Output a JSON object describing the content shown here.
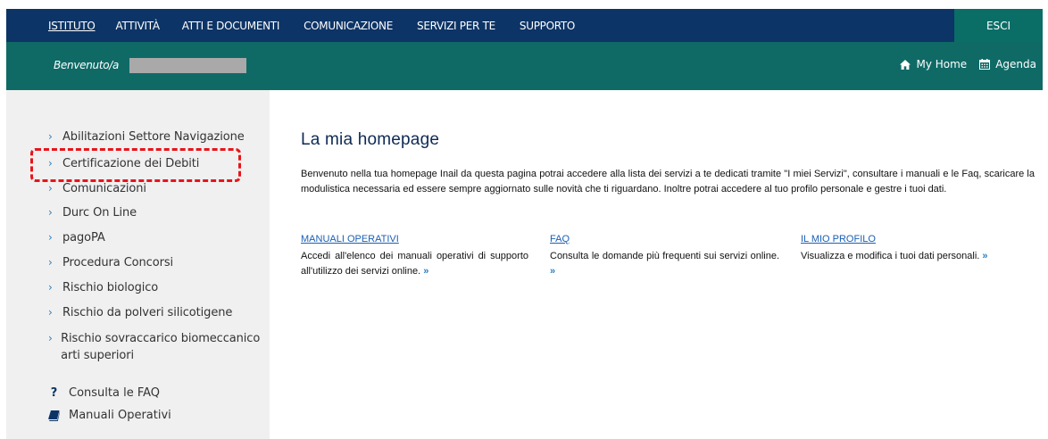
{
  "topnav": {
    "items": [
      "ISTITUTO",
      "ATTIVITÀ",
      "ATTI E DOCUMENTI",
      "COMUNICAZIONE",
      "SERVIZI PER TE",
      "SUPPORTO"
    ],
    "active_index": 0,
    "logout_label": "ESCI",
    "bg_color": "#0d3466",
    "logout_bg_color": "#0a6e67"
  },
  "subbar": {
    "welcome": "Benvenuto/a",
    "my_home_label": "My Home",
    "agenda_label": "Agenda",
    "bg_color": "#0f6a66"
  },
  "sidebar": {
    "items": [
      "Abilitazioni Settore Navigazione",
      "Certificazione dei Debiti",
      "Comunicazioni",
      "Durc On Line",
      "pagoPA",
      "Procedura Concorsi",
      "Rischio biologico",
      "Rischio da polveri silicotigene",
      "Rischio sovraccarico biomeccanico arti superiori"
    ],
    "faq_label": "Consulta le FAQ",
    "manuals_label": "Manuali Operativi",
    "highlighted_item": "Certificazione dei Debiti"
  },
  "main": {
    "title": "La mia homepage",
    "intro": "Benvenuto nella tua homepage Inail da questa pagina potrai accedere alla lista dei servizi a te dedicati tramite \"I miei Servizi\", consultare i manuali e le Faq, scaricare la modulistica necessaria ed essere sempre aggiornato sulle novità che ti riguardano. Inoltre potrai accedere al tuo profilo personale e gestre i tuoi dati.",
    "columns": [
      {
        "title": "MANUALI OPERATIVI",
        "description": "Accedi all'elenco dei manuali operativi di supporto all'utilizzo dei servizi online."
      },
      {
        "title": "FAQ",
        "description": "Consulta le domande più frequenti sui servizi online."
      },
      {
        "title": "IL MIO PROFILO",
        "description": "Visualizza e modifica i tuoi dati personali."
      }
    ],
    "more_glyph": "»"
  }
}
